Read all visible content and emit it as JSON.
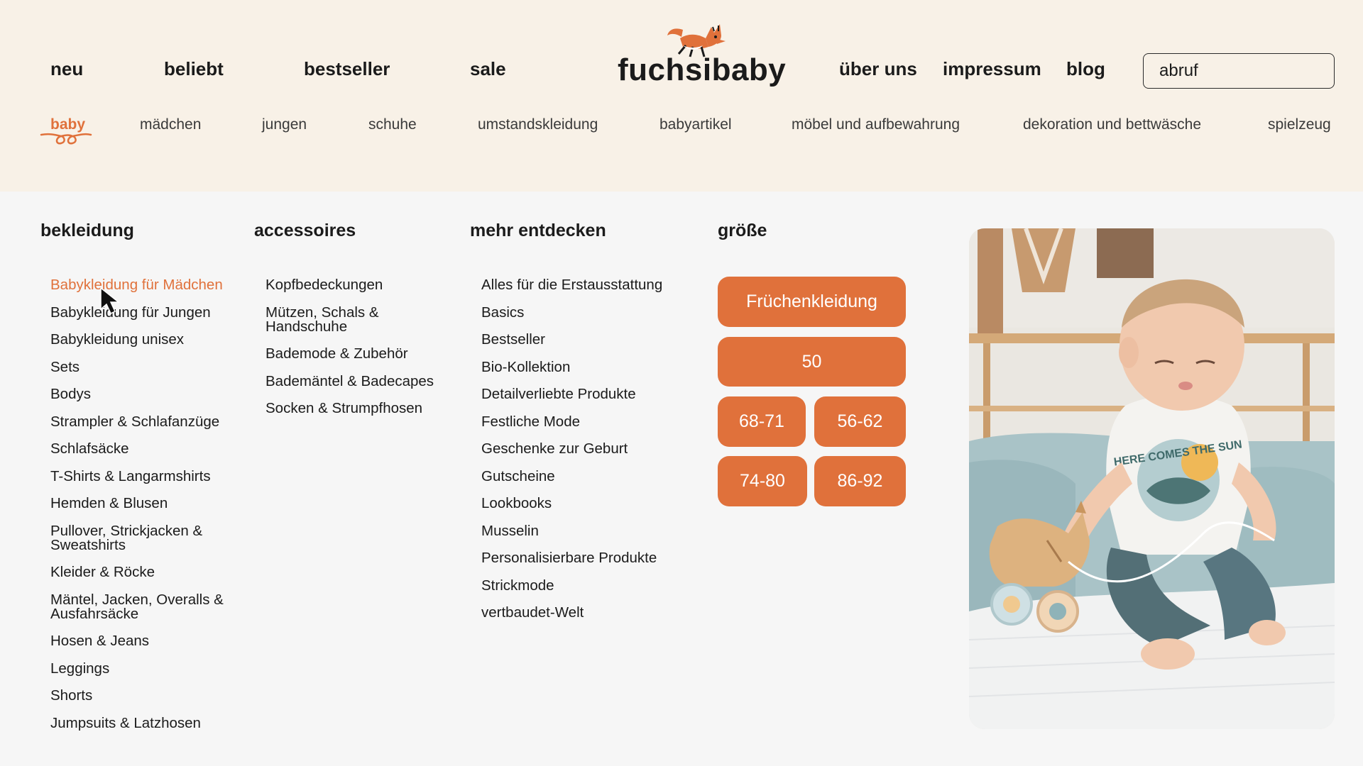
{
  "brand": {
    "name": "fuchsibaby"
  },
  "top_nav_left": [
    "neu",
    "beliebt",
    "bestseller",
    "sale"
  ],
  "top_nav_right": [
    "über uns",
    "impressum",
    "blog"
  ],
  "search": {
    "value": "abruf"
  },
  "categories": {
    "active": "baby",
    "items": [
      "baby",
      "mädchen",
      "jungen",
      "schuhe",
      "umstandskleidung",
      "babyartikel",
      "möbel und aufbewahrung",
      "dekoration und bettwäsche",
      "spielzeug"
    ]
  },
  "columns": {
    "bekleidung": {
      "title": "bekleidung",
      "items": [
        "Babykleidung für Mädchen",
        "Babykleidung für Jungen",
        "Babykleidung unisex",
        "Sets",
        "Bodys",
        "Strampler & Schlafanzüge",
        "Schlafsäcke",
        "T-Shirts & Langarmshirts",
        "Hemden & Blusen",
        "Pullover, Strickjacken & Sweatshirts",
        "Kleider & Röcke",
        "Mäntel, Jacken, Overalls & Ausfahrsäcke",
        "Hosen & Jeans",
        "Leggings",
        "Shorts",
        "Jumpsuits & Latzhosen"
      ]
    },
    "accessoires": {
      "title": "accessoires",
      "items": [
        "Kopfbedeckungen",
        "Mützen, Schals & Handschuhe",
        "Bademode & Zubehör",
        "Bademäntel & Badecapes",
        "Socken & Strumpfhosen"
      ]
    },
    "mehr_entdecken": {
      "title": "mehr entdecken",
      "items": [
        "Alles für die Erstausstattung",
        "Basics",
        "Bestseller",
        "Bio-Kollektion",
        "Detailverliebte Produkte",
        "Festliche Mode",
        "Geschenke zur Geburt",
        "Gutscheine",
        "Lookbooks",
        "Musselin",
        "Personalisierbare Produkte",
        "Strickmode",
        "vertbaudet-Welt"
      ]
    },
    "groesse": {
      "title": "größe",
      "buttons": [
        "Früchenkleidung",
        "50",
        "68-71",
        "56-62",
        "74-80",
        "86-92"
      ]
    }
  },
  "promo_image": {
    "shirt_text": "HERE COMES THE SUN"
  },
  "colors": {
    "accent": "#e0713b",
    "header_bg": "#f8f1e7",
    "page_bg": "#f6f6f6",
    "text": "#1b1b1b"
  }
}
